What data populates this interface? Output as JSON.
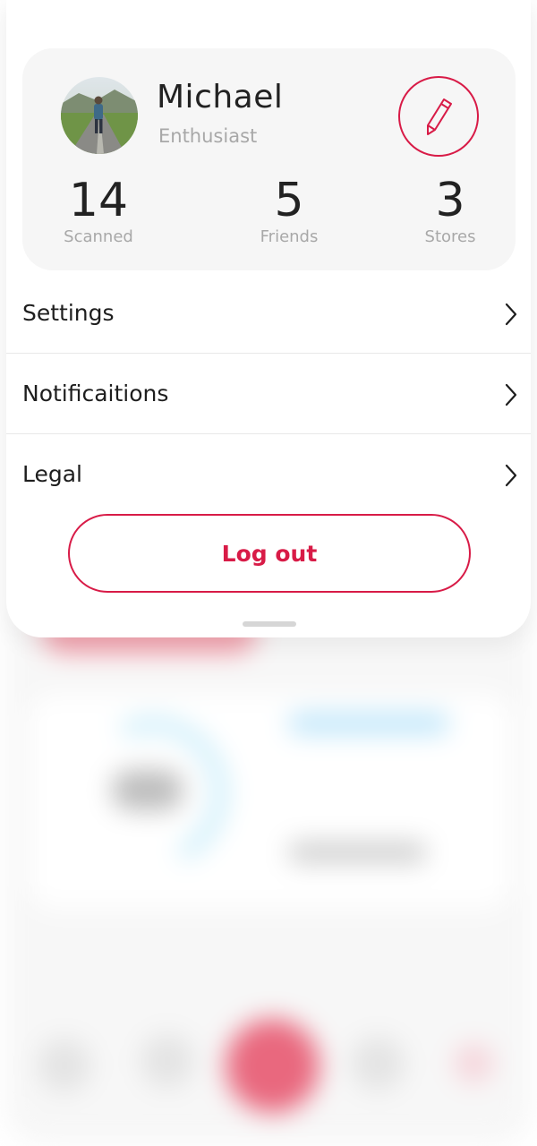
{
  "profile": {
    "name": "Michael",
    "role": "Enthusiast",
    "avatar_icon": "user-photo",
    "edit_icon": "pencil-icon",
    "stats": [
      {
        "value": "14",
        "label": "Scanned"
      },
      {
        "value": "5",
        "label": "Friends"
      },
      {
        "value": "3",
        "label": "Stores"
      }
    ]
  },
  "menu": {
    "items": [
      {
        "label": "Settings",
        "icon": "chevron-right-icon"
      },
      {
        "label": "Notificaitions",
        "icon": "chevron-right-icon"
      },
      {
        "label": "Legal",
        "icon": "chevron-right-icon"
      }
    ]
  },
  "actions": {
    "logout_label": "Log out"
  },
  "colors": {
    "accent": "#d81b47",
    "text": "#222222",
    "muted": "#a8a8a8",
    "card": "#f6f6f6"
  }
}
